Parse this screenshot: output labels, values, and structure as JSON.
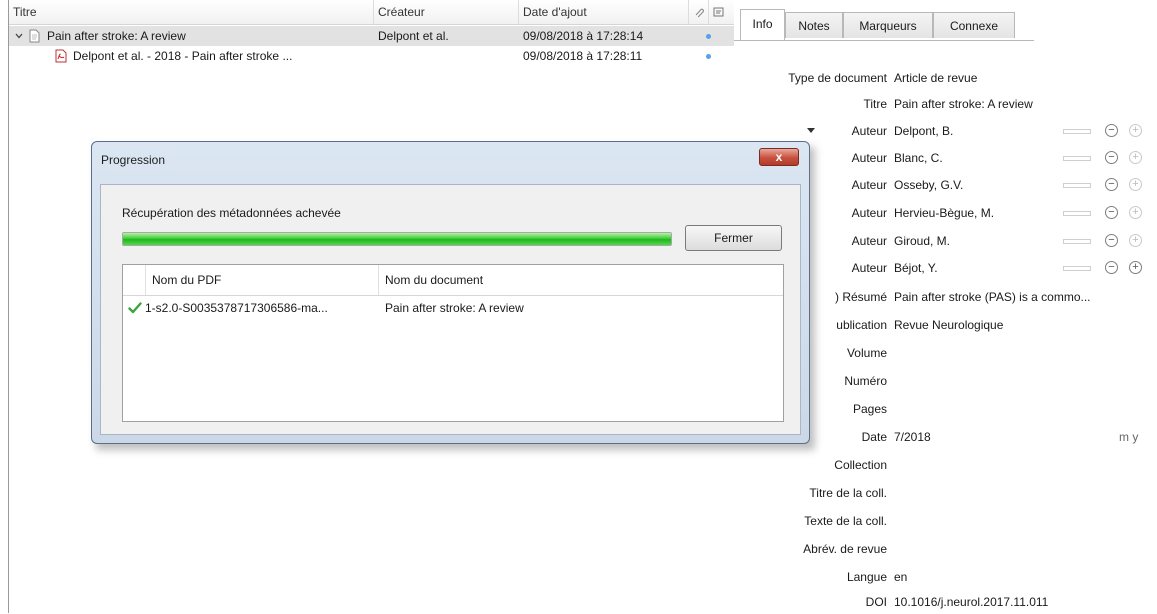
{
  "items": {
    "columns": {
      "title": "Titre",
      "creator": "Créateur",
      "date_added": "Date d'ajout",
      "attachment_icon": "paperclip-icon",
      "notes_icon": "notes-column-icon"
    },
    "rows": [
      {
        "title": "Pain after stroke: A review",
        "creator": "Delpont et al.",
        "date_added": "09/08/2018 à 17:28:14"
      },
      {
        "title": "Delpont et al. - 2018 - Pain after stroke ...",
        "creator": "",
        "date_added": "09/08/2018 à 17:28:11"
      }
    ]
  },
  "info": {
    "tabs": [
      "Info",
      "Notes",
      "Marqueurs",
      "Connexe"
    ],
    "fields": {
      "type": {
        "label": "Type de document",
        "value": "Article de revue"
      },
      "title": {
        "label": "Titre",
        "value": "Pain after stroke: A review"
      },
      "abstract": {
        "label": ") Résumé",
        "value": "Pain after stroke (PAS) is a commo..."
      },
      "publication": {
        "label": "ublication",
        "value": "Revue Neurologique"
      },
      "volume": {
        "label": "Volume",
        "value": ""
      },
      "issue": {
        "label": "Numéro",
        "value": ""
      },
      "pages": {
        "label": "Pages",
        "value": ""
      },
      "date": {
        "label": "Date",
        "value": "7/2018",
        "mode": "m y"
      },
      "series": {
        "label": "Collection",
        "value": ""
      },
      "series_title": {
        "label": "Titre de la coll.",
        "value": ""
      },
      "series_text": {
        "label": "Texte de la coll.",
        "value": ""
      },
      "journal_abbr": {
        "label": "Abrév. de revue",
        "value": ""
      },
      "language": {
        "label": "Langue",
        "value": "en"
      },
      "doi": {
        "label": "DOI",
        "value": "10.1016/j.neurol.2017.11.011"
      }
    },
    "author_label": "Auteur",
    "authors": [
      "Delpont, B.",
      "Blanc, C.",
      "Osseby, G.V.",
      "Hervieu-Bègue, M.",
      "Giroud, M.",
      "Béjot, Y."
    ]
  },
  "dialog": {
    "title": "Progression",
    "close_symbol": "x",
    "status": "Récupération des métadonnées achevée",
    "progress": 1.0,
    "button": "Fermer",
    "col_pdf": "Nom du PDF",
    "col_doc": "Nom du document",
    "result": {
      "pdf": "1-s2.0-S0035378717306586-ma...",
      "doc": "Pain after stroke: A review"
    }
  }
}
